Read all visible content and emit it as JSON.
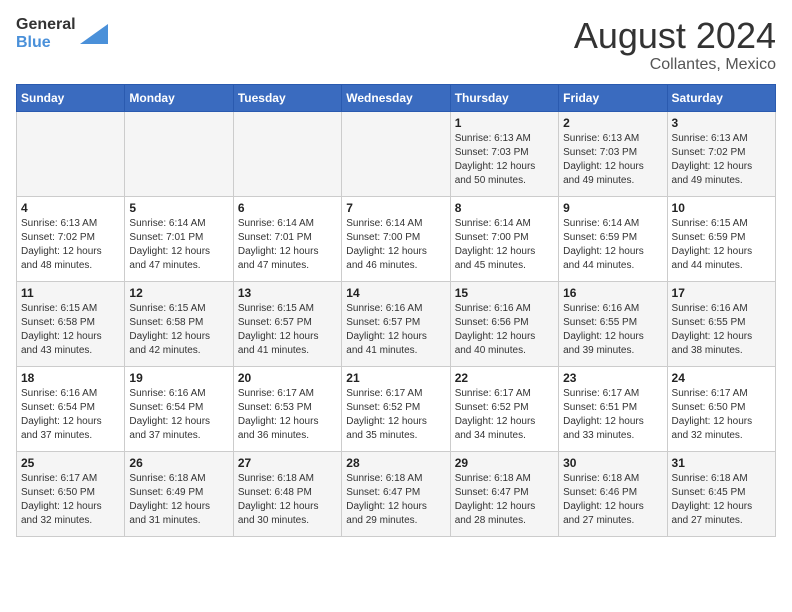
{
  "logo": {
    "line1": "General",
    "line2": "Blue"
  },
  "title": "August 2024",
  "subtitle": "Collantes, Mexico",
  "days_of_week": [
    "Sunday",
    "Monday",
    "Tuesday",
    "Wednesday",
    "Thursday",
    "Friday",
    "Saturday"
  ],
  "weeks": [
    [
      {
        "day": "",
        "info": ""
      },
      {
        "day": "",
        "info": ""
      },
      {
        "day": "",
        "info": ""
      },
      {
        "day": "",
        "info": ""
      },
      {
        "day": "1",
        "info": "Sunrise: 6:13 AM\nSunset: 7:03 PM\nDaylight: 12 hours\nand 50 minutes."
      },
      {
        "day": "2",
        "info": "Sunrise: 6:13 AM\nSunset: 7:03 PM\nDaylight: 12 hours\nand 49 minutes."
      },
      {
        "day": "3",
        "info": "Sunrise: 6:13 AM\nSunset: 7:02 PM\nDaylight: 12 hours\nand 49 minutes."
      }
    ],
    [
      {
        "day": "4",
        "info": "Sunrise: 6:13 AM\nSunset: 7:02 PM\nDaylight: 12 hours\nand 48 minutes."
      },
      {
        "day": "5",
        "info": "Sunrise: 6:14 AM\nSunset: 7:01 PM\nDaylight: 12 hours\nand 47 minutes."
      },
      {
        "day": "6",
        "info": "Sunrise: 6:14 AM\nSunset: 7:01 PM\nDaylight: 12 hours\nand 47 minutes."
      },
      {
        "day": "7",
        "info": "Sunrise: 6:14 AM\nSunset: 7:00 PM\nDaylight: 12 hours\nand 46 minutes."
      },
      {
        "day": "8",
        "info": "Sunrise: 6:14 AM\nSunset: 7:00 PM\nDaylight: 12 hours\nand 45 minutes."
      },
      {
        "day": "9",
        "info": "Sunrise: 6:14 AM\nSunset: 6:59 PM\nDaylight: 12 hours\nand 44 minutes."
      },
      {
        "day": "10",
        "info": "Sunrise: 6:15 AM\nSunset: 6:59 PM\nDaylight: 12 hours\nand 44 minutes."
      }
    ],
    [
      {
        "day": "11",
        "info": "Sunrise: 6:15 AM\nSunset: 6:58 PM\nDaylight: 12 hours\nand 43 minutes."
      },
      {
        "day": "12",
        "info": "Sunrise: 6:15 AM\nSunset: 6:58 PM\nDaylight: 12 hours\nand 42 minutes."
      },
      {
        "day": "13",
        "info": "Sunrise: 6:15 AM\nSunset: 6:57 PM\nDaylight: 12 hours\nand 41 minutes."
      },
      {
        "day": "14",
        "info": "Sunrise: 6:16 AM\nSunset: 6:57 PM\nDaylight: 12 hours\nand 41 minutes."
      },
      {
        "day": "15",
        "info": "Sunrise: 6:16 AM\nSunset: 6:56 PM\nDaylight: 12 hours\nand 40 minutes."
      },
      {
        "day": "16",
        "info": "Sunrise: 6:16 AM\nSunset: 6:55 PM\nDaylight: 12 hours\nand 39 minutes."
      },
      {
        "day": "17",
        "info": "Sunrise: 6:16 AM\nSunset: 6:55 PM\nDaylight: 12 hours\nand 38 minutes."
      }
    ],
    [
      {
        "day": "18",
        "info": "Sunrise: 6:16 AM\nSunset: 6:54 PM\nDaylight: 12 hours\nand 37 minutes."
      },
      {
        "day": "19",
        "info": "Sunrise: 6:16 AM\nSunset: 6:54 PM\nDaylight: 12 hours\nand 37 minutes."
      },
      {
        "day": "20",
        "info": "Sunrise: 6:17 AM\nSunset: 6:53 PM\nDaylight: 12 hours\nand 36 minutes."
      },
      {
        "day": "21",
        "info": "Sunrise: 6:17 AM\nSunset: 6:52 PM\nDaylight: 12 hours\nand 35 minutes."
      },
      {
        "day": "22",
        "info": "Sunrise: 6:17 AM\nSunset: 6:52 PM\nDaylight: 12 hours\nand 34 minutes."
      },
      {
        "day": "23",
        "info": "Sunrise: 6:17 AM\nSunset: 6:51 PM\nDaylight: 12 hours\nand 33 minutes."
      },
      {
        "day": "24",
        "info": "Sunrise: 6:17 AM\nSunset: 6:50 PM\nDaylight: 12 hours\nand 32 minutes."
      }
    ],
    [
      {
        "day": "25",
        "info": "Sunrise: 6:17 AM\nSunset: 6:50 PM\nDaylight: 12 hours\nand 32 minutes."
      },
      {
        "day": "26",
        "info": "Sunrise: 6:18 AM\nSunset: 6:49 PM\nDaylight: 12 hours\nand 31 minutes."
      },
      {
        "day": "27",
        "info": "Sunrise: 6:18 AM\nSunset: 6:48 PM\nDaylight: 12 hours\nand 30 minutes."
      },
      {
        "day": "28",
        "info": "Sunrise: 6:18 AM\nSunset: 6:47 PM\nDaylight: 12 hours\nand 29 minutes."
      },
      {
        "day": "29",
        "info": "Sunrise: 6:18 AM\nSunset: 6:47 PM\nDaylight: 12 hours\nand 28 minutes."
      },
      {
        "day": "30",
        "info": "Sunrise: 6:18 AM\nSunset: 6:46 PM\nDaylight: 12 hours\nand 27 minutes."
      },
      {
        "day": "31",
        "info": "Sunrise: 6:18 AM\nSunset: 6:45 PM\nDaylight: 12 hours\nand 27 minutes."
      }
    ]
  ]
}
